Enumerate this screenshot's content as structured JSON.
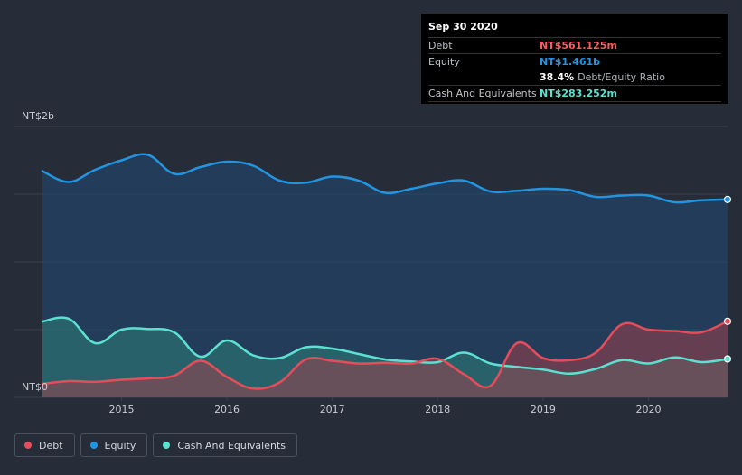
{
  "tooltip": {
    "date": "Sep 30 2020",
    "debt_label": "Debt",
    "debt_value": "NT$561.125m",
    "equity_label": "Equity",
    "equity_value": "NT$1.461b",
    "ratio_value": "38.4%",
    "ratio_label": "Debt/Equity Ratio",
    "cash_label": "Cash And Equivalents",
    "cash_value": "NT$283.252m"
  },
  "legend": {
    "debt": "Debt",
    "equity": "Equity",
    "cash": "Cash And Equivalents"
  },
  "colors": {
    "background": "#262c38",
    "debt": "#e64d5a",
    "equity": "#2394df",
    "cash": "#5ce0d0",
    "grid": "#3a404c",
    "text": "#c8ccd2",
    "tooltip_debt": "#ff5a5f",
    "tooltip_equity": "#2394df",
    "tooltip_cash": "#5ce0d0"
  },
  "chart_data": {
    "type": "area",
    "ylim": [
      0,
      2000
    ],
    "xlim": [
      2014.25,
      2020.75
    ],
    "y_tick_labels": [
      {
        "value": 2000,
        "label": "NT$2b"
      },
      {
        "value": 0,
        "label": "NT$0"
      }
    ],
    "gridlines": [
      0,
      500,
      1000,
      1500,
      2000
    ],
    "x_ticks": [
      {
        "value": 2015,
        "label": "2015"
      },
      {
        "value": 2016,
        "label": "2016"
      },
      {
        "value": 2017,
        "label": "2017"
      },
      {
        "value": 2018,
        "label": "2018"
      },
      {
        "value": 2019,
        "label": "2019"
      },
      {
        "value": 2020,
        "label": "2020"
      }
    ],
    "series": [
      {
        "name": "Equity",
        "key": "equity",
        "points": [
          [
            2014.25,
            1670
          ],
          [
            2014.5,
            1590
          ],
          [
            2014.75,
            1680
          ],
          [
            2015.0,
            1750
          ],
          [
            2015.25,
            1790
          ],
          [
            2015.5,
            1650
          ],
          [
            2015.75,
            1700
          ],
          [
            2016.0,
            1740
          ],
          [
            2016.25,
            1710
          ],
          [
            2016.5,
            1600
          ],
          [
            2016.75,
            1585
          ],
          [
            2017.0,
            1630
          ],
          [
            2017.25,
            1600
          ],
          [
            2017.5,
            1510
          ],
          [
            2017.75,
            1540
          ],
          [
            2018.0,
            1580
          ],
          [
            2018.25,
            1600
          ],
          [
            2018.5,
            1520
          ],
          [
            2018.75,
            1525
          ],
          [
            2019.0,
            1540
          ],
          [
            2019.25,
            1530
          ],
          [
            2019.5,
            1480
          ],
          [
            2019.75,
            1490
          ],
          [
            2020.0,
            1490
          ],
          [
            2020.25,
            1440
          ],
          [
            2020.5,
            1455
          ],
          [
            2020.75,
            1461
          ]
        ]
      },
      {
        "name": "Cash And Equivalents",
        "key": "cash",
        "points": [
          [
            2014.25,
            560
          ],
          [
            2014.5,
            580
          ],
          [
            2014.75,
            400
          ],
          [
            2015.0,
            500
          ],
          [
            2015.25,
            505
          ],
          [
            2015.5,
            480
          ],
          [
            2015.75,
            300
          ],
          [
            2016.0,
            420
          ],
          [
            2016.25,
            310
          ],
          [
            2016.5,
            290
          ],
          [
            2016.75,
            370
          ],
          [
            2017.0,
            360
          ],
          [
            2017.25,
            320
          ],
          [
            2017.5,
            280
          ],
          [
            2017.75,
            265
          ],
          [
            2018.0,
            260
          ],
          [
            2018.25,
            330
          ],
          [
            2018.5,
            250
          ],
          [
            2018.75,
            225
          ],
          [
            2019.0,
            205
          ],
          [
            2019.25,
            175
          ],
          [
            2019.5,
            210
          ],
          [
            2019.75,
            275
          ],
          [
            2020.0,
            250
          ],
          [
            2020.25,
            295
          ],
          [
            2020.5,
            260
          ],
          [
            2020.75,
            283.252
          ]
        ]
      },
      {
        "name": "Debt",
        "key": "debt",
        "points": [
          [
            2014.25,
            100
          ],
          [
            2014.5,
            120
          ],
          [
            2014.75,
            115
          ],
          [
            2015.0,
            130
          ],
          [
            2015.25,
            140
          ],
          [
            2015.5,
            160
          ],
          [
            2015.75,
            270
          ],
          [
            2016.0,
            150
          ],
          [
            2016.25,
            65
          ],
          [
            2016.5,
            110
          ],
          [
            2016.75,
            280
          ],
          [
            2017.0,
            270
          ],
          [
            2017.25,
            250
          ],
          [
            2017.5,
            255
          ],
          [
            2017.75,
            250
          ],
          [
            2018.0,
            285
          ],
          [
            2018.25,
            170
          ],
          [
            2018.5,
            85
          ],
          [
            2018.75,
            400
          ],
          [
            2019.0,
            290
          ],
          [
            2019.25,
            275
          ],
          [
            2019.5,
            330
          ],
          [
            2019.75,
            540
          ],
          [
            2020.0,
            500
          ],
          [
            2020.25,
            490
          ],
          [
            2020.5,
            480
          ],
          [
            2020.75,
            561.125
          ]
        ]
      }
    ]
  }
}
